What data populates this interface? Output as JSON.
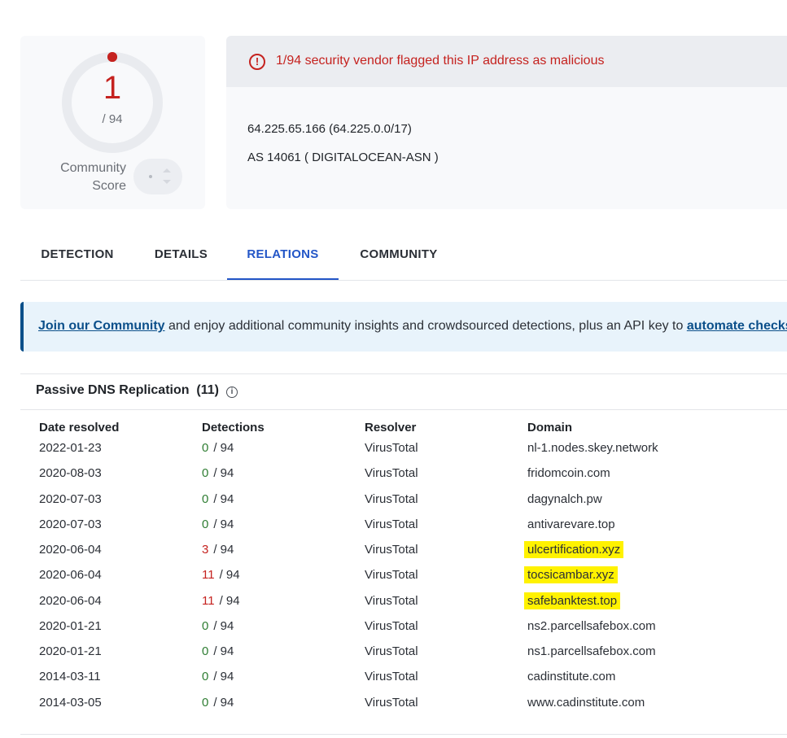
{
  "score": {
    "detections": "1",
    "total": "/ 94",
    "community_label_line1": "Community",
    "community_label_line2": "Score"
  },
  "alert": {
    "icon": "exclamation-circle-icon",
    "text": "1/94 security vendor flagged this IP address as malicious",
    "color": "#c5221f"
  },
  "ip_info": {
    "ip_line": "64.225.65.166  (64.225.0.0/17)",
    "as_line": "AS 14061  ( DIGITALOCEAN-ASN )"
  },
  "tabs": [
    {
      "label": "DETECTION",
      "active": false
    },
    {
      "label": "DETAILS",
      "active": false
    },
    {
      "label": "RELATIONS",
      "active": true
    },
    {
      "label": "COMMUNITY",
      "active": false
    }
  ],
  "banner": {
    "link1": "Join our Community",
    "middle": " and enjoy additional community insights and crowdsourced detections, plus an API key to ",
    "link2": "automate checks."
  },
  "passive_dns": {
    "title": "Passive DNS Replication",
    "count": "(11)",
    "columns": [
      "Date resolved",
      "Detections",
      "Resolver",
      "Domain"
    ],
    "rows": [
      {
        "date": "2022-01-23",
        "det": "0",
        "total": "/ 94",
        "resolver": "VirusTotal",
        "domain": "nl-1.nodes.skey.network",
        "highlight": false
      },
      {
        "date": "2020-08-03",
        "det": "0",
        "total": "/ 94",
        "resolver": "VirusTotal",
        "domain": "fridomcoin.com",
        "highlight": false
      },
      {
        "date": "2020-07-03",
        "det": "0",
        "total": "/ 94",
        "resolver": "VirusTotal",
        "domain": "dagynalch.pw",
        "highlight": false
      },
      {
        "date": "2020-07-03",
        "det": "0",
        "total": "/ 94",
        "resolver": "VirusTotal",
        "domain": "antivarevare.top",
        "highlight": false
      },
      {
        "date": "2020-06-04",
        "det": "3",
        "total": "/ 94",
        "resolver": "VirusTotal",
        "domain": "ulcertification.xyz",
        "highlight": true
      },
      {
        "date": "2020-06-04",
        "det": "11",
        "total": "/ 94",
        "resolver": "VirusTotal",
        "domain": "tocsicambar.xyz",
        "highlight": true
      },
      {
        "date": "2020-06-04",
        "det": "11",
        "total": "/ 94",
        "resolver": "VirusTotal",
        "domain": "safebanktest.top",
        "highlight": true
      },
      {
        "date": "2020-01-21",
        "det": "0",
        "total": "/ 94",
        "resolver": "VirusTotal",
        "domain": "ns2.parcellsafebox.com",
        "highlight": false
      },
      {
        "date": "2020-01-21",
        "det": "0",
        "total": "/ 94",
        "resolver": "VirusTotal",
        "domain": "ns1.parcellsafebox.com",
        "highlight": false
      },
      {
        "date": "2014-03-11",
        "det": "0",
        "total": "/ 94",
        "resolver": "VirusTotal",
        "domain": "cadinstitute.com",
        "highlight": false
      },
      {
        "date": "2014-03-05",
        "det": "0",
        "total": "/ 94",
        "resolver": "VirusTotal",
        "domain": "www.cadinstitute.com",
        "highlight": false
      }
    ]
  },
  "colors": {
    "malicious": "#c5221f",
    "clean": "#2e7d32",
    "accent": "#2356c7",
    "highlight": "#fff200"
  }
}
